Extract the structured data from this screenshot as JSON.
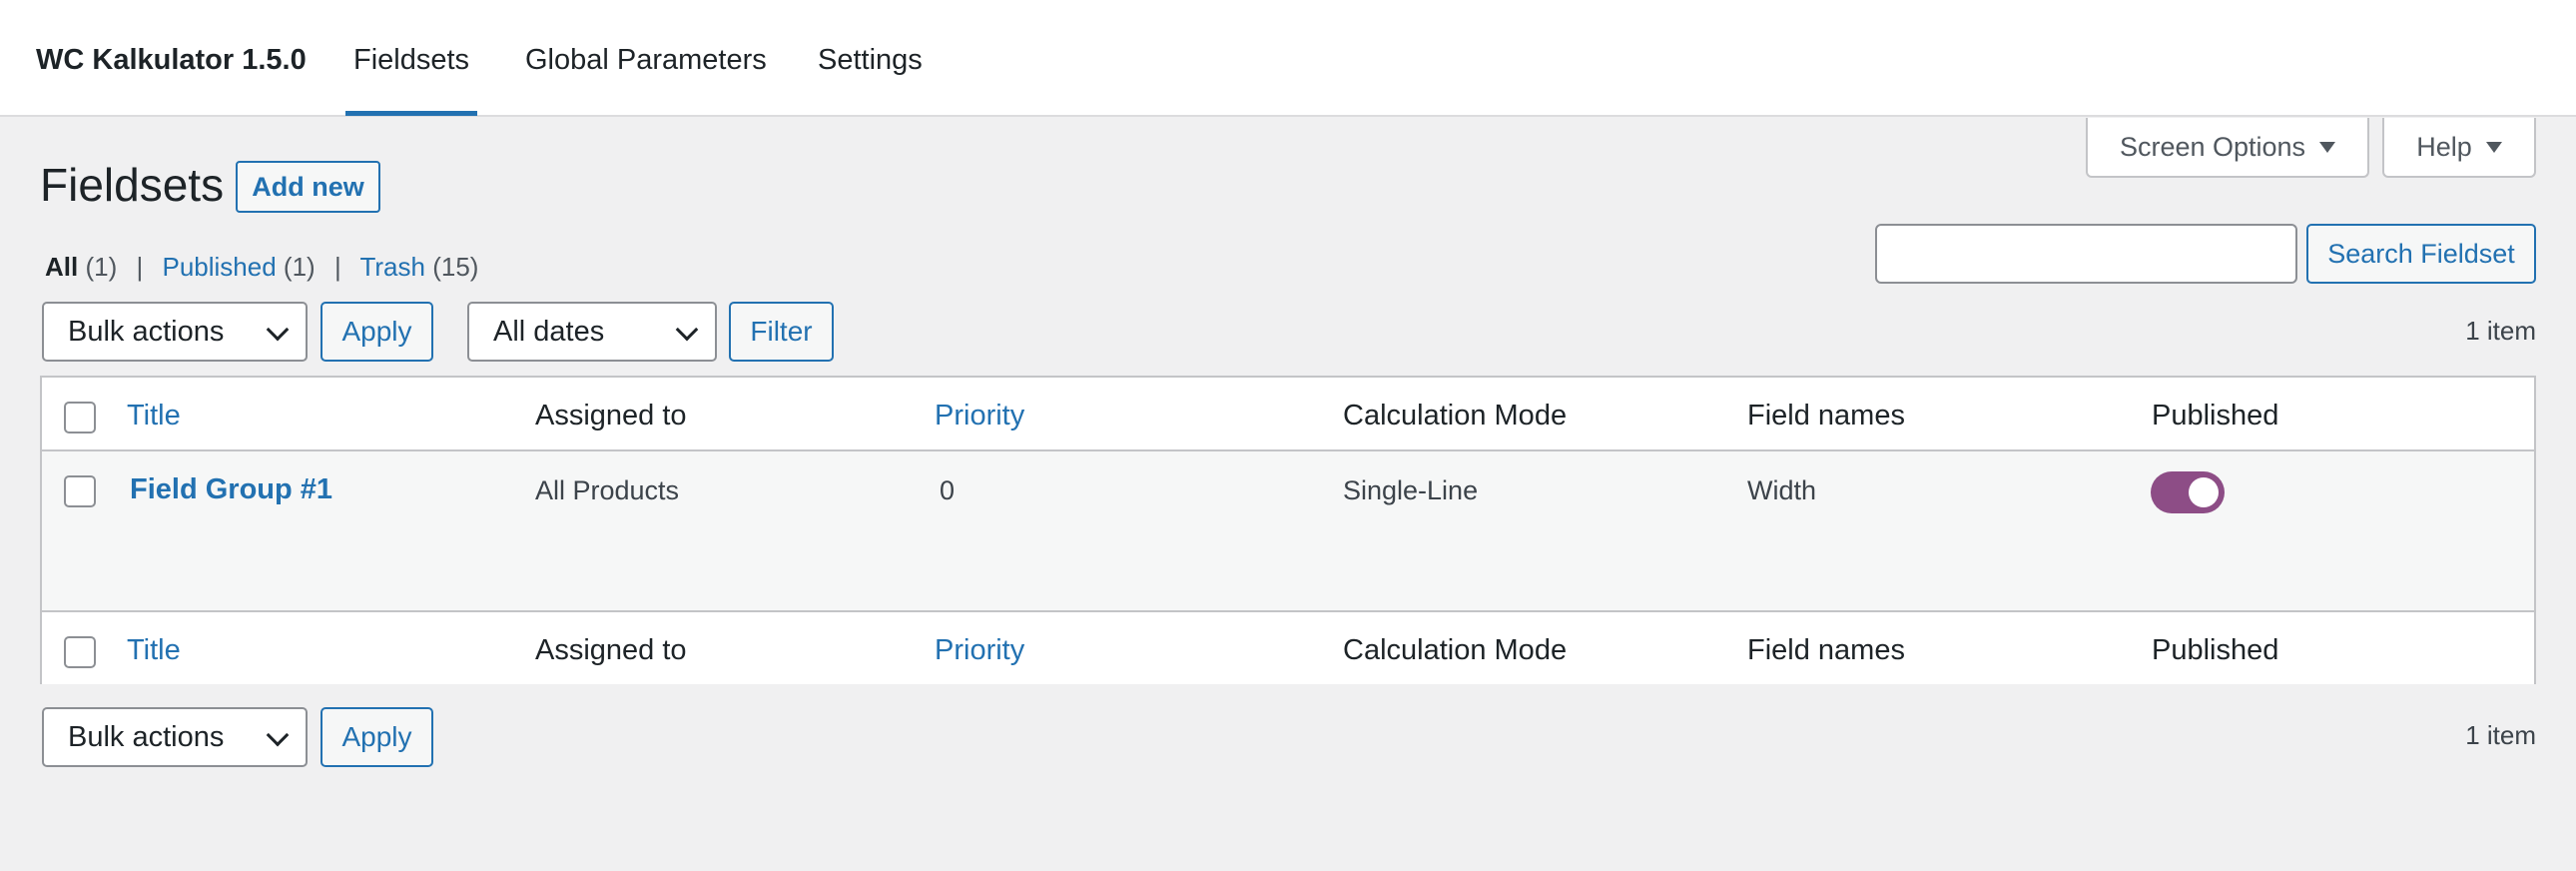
{
  "topbar": {
    "brand": "WC Kalkulator 1.5.0",
    "tabs": [
      {
        "label": "Fieldsets",
        "active": true
      },
      {
        "label": "Global Parameters",
        "active": false
      },
      {
        "label": "Settings",
        "active": false
      }
    ]
  },
  "screen_meta": {
    "screen_options": "Screen Options",
    "help": "Help"
  },
  "page": {
    "title": "Fieldsets",
    "add_new": "Add new"
  },
  "filters": {
    "all": "All",
    "all_count": "(1)",
    "published": "Published",
    "published_count": "(1)",
    "trash": "Trash",
    "trash_count": "(15)",
    "separator": "|"
  },
  "search": {
    "value": "",
    "button": "Search Fieldset"
  },
  "tablenav_top": {
    "bulk_actions": "Bulk actions",
    "apply": "Apply",
    "dates": "All dates",
    "filter": "Filter",
    "count": "1 item"
  },
  "tablenav_bottom": {
    "bulk_actions": "Bulk actions",
    "apply": "Apply",
    "count": "1 item"
  },
  "table": {
    "columns": [
      "Title",
      "Assigned to",
      "Priority",
      "Calculation Mode",
      "Field names",
      "Published"
    ],
    "rows": [
      {
        "title": "Field Group #1",
        "assigned_to": "All Products",
        "priority": "0",
        "calculation_mode": "Single-Line",
        "field_names": "Width",
        "published": true
      }
    ]
  },
  "colors": {
    "accent": "#2271b1",
    "toggle_on": "#8d4d86",
    "background": "#f0f0f1"
  }
}
